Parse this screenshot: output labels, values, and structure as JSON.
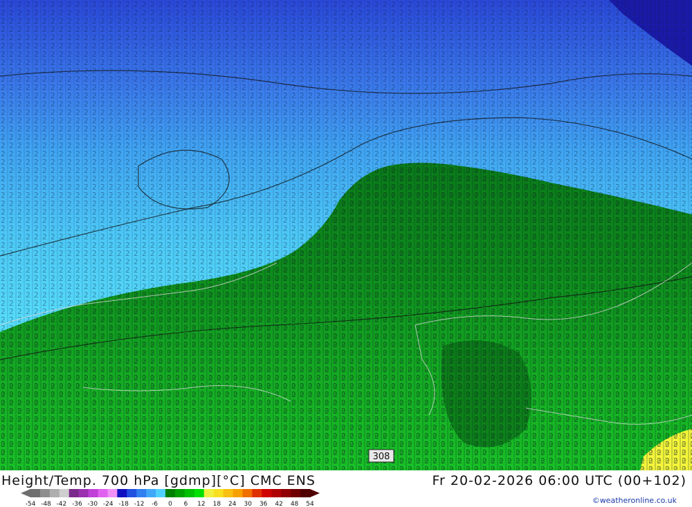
{
  "header": {
    "title": "Height/Temp. 700 hPa [gdmp][°C] CMC ENS",
    "valid_time": "Fr 20-02-2026 06:00 UTC (00+102)"
  },
  "credit": "©weatheronline.co.uk",
  "contour_label": "308",
  "legend": {
    "ticks": [
      "-54",
      "-48",
      "-42",
      "-36",
      "-30",
      "-24",
      "-18",
      "-12",
      "-6",
      "0",
      "6",
      "12",
      "18",
      "24",
      "30",
      "36",
      "42",
      "48",
      "54"
    ],
    "colors": [
      "#6e6e6e",
      "#8e8e8e",
      "#aeaeae",
      "#cecece",
      "#7a2a8a",
      "#9a30b0",
      "#c040d8",
      "#e060f0",
      "#f090f8",
      "#1010c0",
      "#2050e0",
      "#3080f0",
      "#40a8f8",
      "#50d0ff",
      "#008000",
      "#00a000",
      "#00c000",
      "#00e000",
      "#f0f040",
      "#f8e020",
      "#f8c010",
      "#f8a000",
      "#f07000",
      "#e03000",
      "#d00000",
      "#b00000",
      "#900000",
      "#700000",
      "#500000"
    ]
  },
  "field_digits": [
    "2",
    "5",
    "7",
    "9",
    "1",
    "3",
    "0"
  ]
}
